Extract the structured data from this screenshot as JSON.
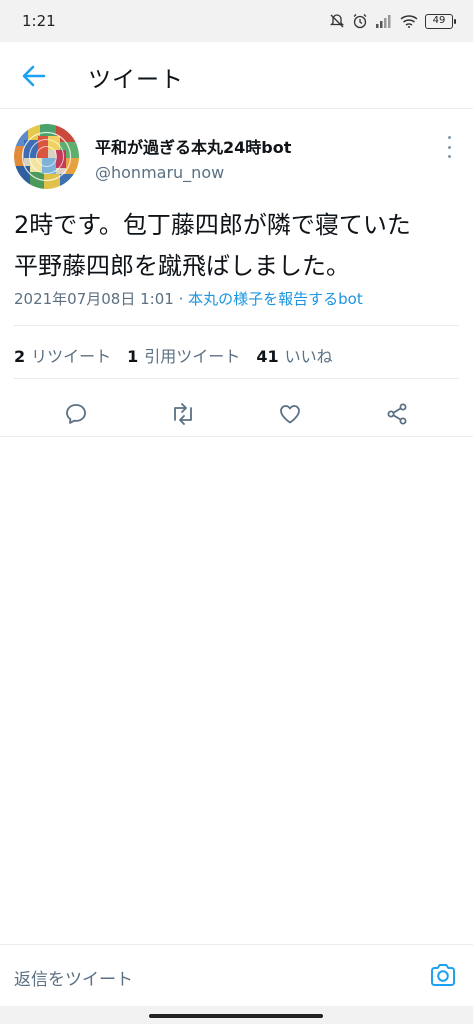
{
  "status_bar": {
    "time": "1:21",
    "battery": "49"
  },
  "header": {
    "title": "ツイート"
  },
  "tweet": {
    "display_name": "平和が過ぎる本丸24時bot",
    "handle": "@honmaru_now",
    "text_line1": "2時です。包丁藤四郎が隣で寝ていた",
    "text_line2": "平野藤四郎を蹴飛ばしました。",
    "timestamp": "2021年07月08日 1:01",
    "separator": " · ",
    "client": "本丸の様子を報告するbot"
  },
  "stats": {
    "retweets_count": "2",
    "retweets_label": "リツイート",
    "quotes_count": "1",
    "quotes_label": "引用ツイート",
    "likes_count": "41",
    "likes_label": "いいね"
  },
  "reply": {
    "placeholder": "返信をツイート"
  },
  "icons": {
    "back": "back-arrow-icon",
    "more": "more-vertical-icon",
    "reply": "reply-icon",
    "retweet": "retweet-icon",
    "like": "heart-icon",
    "share": "share-icon",
    "camera": "camera-icon"
  },
  "colors": {
    "accent": "#1da1f2",
    "secondary_text": "#5b7083",
    "link": "#1b95e0"
  }
}
